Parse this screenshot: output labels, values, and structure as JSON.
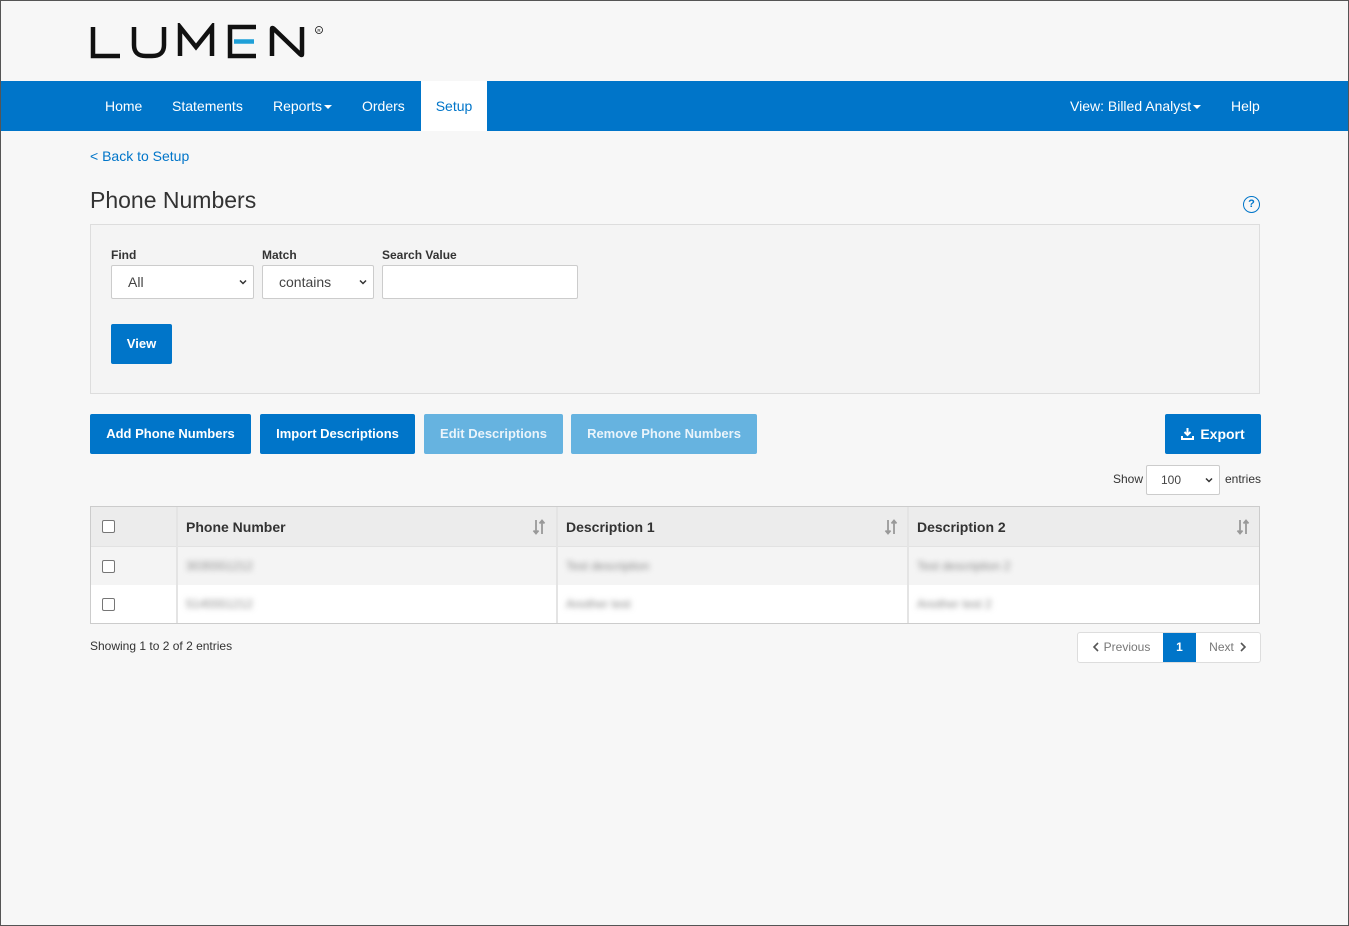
{
  "brand": {
    "logo_text": "LUMEN"
  },
  "nav": {
    "home": "Home",
    "statements": "Statements",
    "reports": "Reports",
    "orders": "Orders",
    "setup": "Setup",
    "view_role": "View: Billed Analyst",
    "help": "Help"
  },
  "breadcrumb": {
    "back": "< Back to Setup"
  },
  "page": {
    "title": "Phone Numbers",
    "help_icon": "?"
  },
  "search": {
    "find_label": "Find",
    "find_value": "All",
    "match_label": "Match",
    "match_value": "contains",
    "value_label": "Search Value",
    "value": "",
    "view_button": "View"
  },
  "actions": {
    "add": "Add Phone Numbers",
    "import": "Import Descriptions",
    "edit": "Edit Descriptions",
    "remove": "Remove Phone Numbers",
    "export": "Export"
  },
  "length": {
    "show": "Show",
    "value": "100",
    "entries": "entries"
  },
  "table": {
    "columns": [
      "Phone Number",
      "Description 1",
      "Description 2"
    ],
    "rows": [
      {
        "phone": "3035551212",
        "desc1": "Test description",
        "desc2": "Test description 2"
      },
      {
        "phone": "5145551212",
        "desc1": "Another test",
        "desc2": "Another test 2"
      }
    ]
  },
  "footer": {
    "showing": "Showing 1 to 2 of 2 entries",
    "previous": "Previous",
    "page": "1",
    "next": "Next"
  },
  "colors": {
    "primary": "#0075c9",
    "disabled": "#66b3e0"
  }
}
